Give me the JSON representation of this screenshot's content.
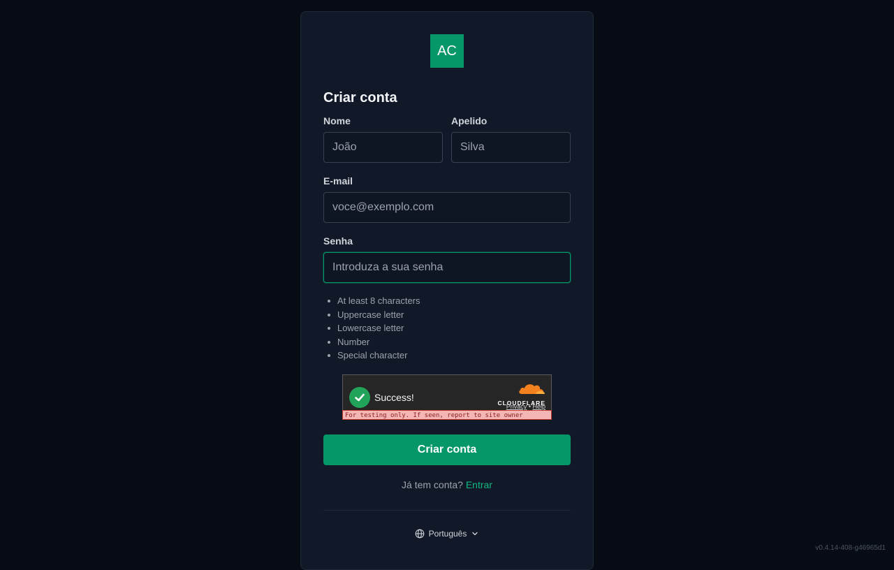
{
  "brand": {
    "logo_text": "AC",
    "color": "#059669"
  },
  "form": {
    "title": "Criar conta",
    "first_name": {
      "label": "Nome",
      "placeholder": "João"
    },
    "last_name": {
      "label": "Apelido",
      "placeholder": "Silva"
    },
    "email": {
      "label": "E-mail",
      "placeholder": "voce@exemplo.com"
    },
    "password": {
      "label": "Senha",
      "placeholder": "Introduza a sua senha"
    },
    "requirements": [
      "At least 8 characters",
      "Uppercase letter",
      "Lowercase letter",
      "Number",
      "Special character"
    ],
    "submit_label": "Criar conta",
    "signin_prompt": "Já tem conta?",
    "signin_link": "Entrar"
  },
  "captcha": {
    "status": "Success!",
    "provider": "CLOUDFLARE",
    "privacy": "Privacy",
    "separator": "•",
    "help": "Help",
    "warning": "For testing only. If seen, report to site owner"
  },
  "language": {
    "selected": "Português",
    "icon": "globe-icon"
  },
  "version": "v0.4.14-408-g46965d1"
}
